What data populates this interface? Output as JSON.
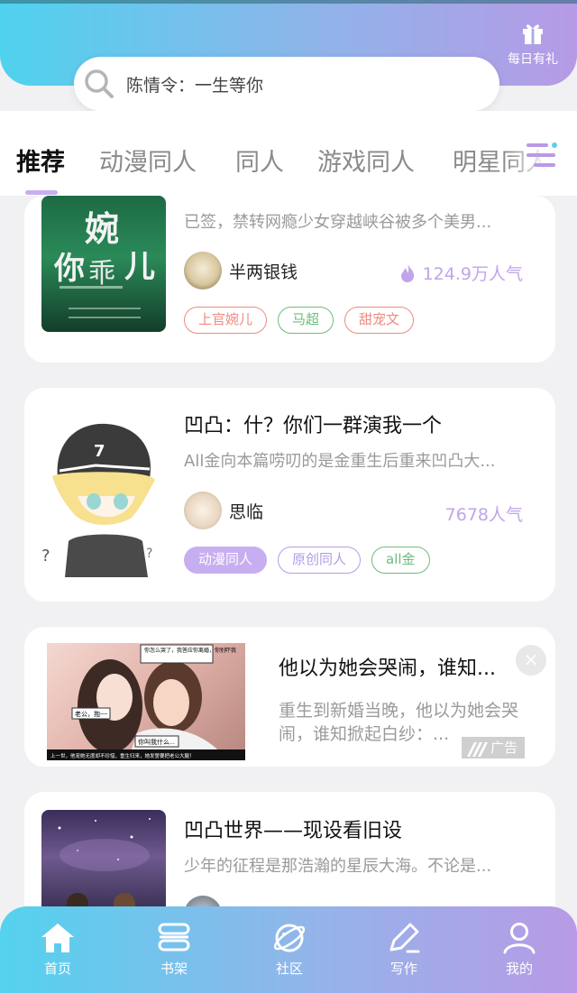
{
  "header": {
    "gift_label": "每日有礼",
    "search_text": "陈情令：一生等你"
  },
  "tabs": [
    {
      "label": "推荐",
      "active": true
    },
    {
      "label": "动漫同人",
      "active": false
    },
    {
      "label": "同人",
      "active": false
    },
    {
      "label": "游戏同人",
      "active": false
    },
    {
      "label": "明星同人",
      "active": false
    }
  ],
  "cards": [
    {
      "desc": "已签，禁转网瘾少女穿越峡谷被多个美男...",
      "author": "半两银钱",
      "popularity": "124.9万人气",
      "tags": [
        "上官婉儿",
        "马超",
        "甜宠文"
      ],
      "tag_colors": [
        "#ef8a80",
        "#6cbd7c",
        "#ef8a80"
      ]
    },
    {
      "title": "凹凸：什？你们一群演我一个",
      "desc": "All金向本篇唠叨的是金重生后重来凹凸大...",
      "author": "思临",
      "popularity": "7678人气",
      "tags": [
        "动漫同人",
        "原创同人",
        "all金"
      ],
      "tag_colors": [
        "#c7aef0",
        "#b79ae6",
        "#6cbd7c"
      ]
    },
    {
      "title": "凹凸世界——现设看旧设",
      "desc": "少年的征程是那浩瀚的星辰大海。不论是..."
    }
  ],
  "ad": {
    "title": "他以为她会哭闹，谁知...",
    "desc": "重生到新婚当晚，他以为她会哭闹，谁知掀起白纱：...",
    "badge": "广告",
    "close": "×",
    "bubbles": [
      "你怎么哭了，我答应你离婚，你别吓我",
      "老公，抱~~",
      "你叫我什么...",
      "上一世，他宠她无度却不珍惜，重生归来，她发誓要把老公大腿！"
    ]
  },
  "nav": [
    {
      "label": "首页",
      "icon": "home-icon"
    },
    {
      "label": "书架",
      "icon": "bookshelf-icon"
    },
    {
      "label": "社区",
      "icon": "planet-icon"
    },
    {
      "label": "写作",
      "icon": "pen-icon"
    },
    {
      "label": "我的",
      "icon": "user-icon"
    }
  ],
  "colors": {
    "accent": "#c7aef0",
    "header_start": "#4fd2ee",
    "header_end": "#b69ae6",
    "popularity": "#c0a5ea"
  }
}
